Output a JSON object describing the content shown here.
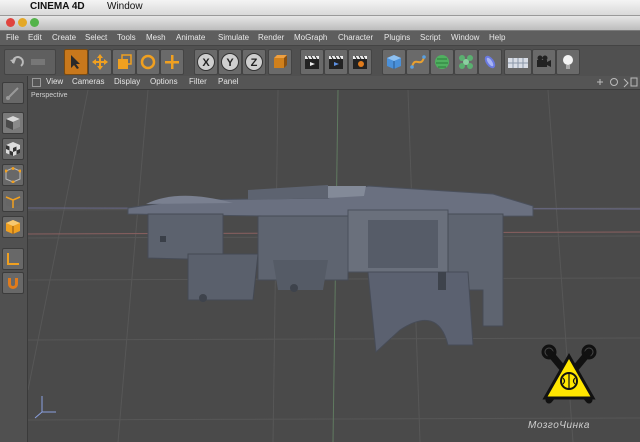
{
  "os_menubar": {
    "apple": "",
    "app": "CINEMA 4D",
    "window": "Window"
  },
  "app_menu": {
    "items": [
      "File",
      "Edit",
      "Create",
      "Select",
      "Tools",
      "Mesh",
      "Animate",
      "Simulate",
      "Render",
      "MoGraph",
      "Character",
      "Plugins",
      "Script",
      "Window",
      "Help"
    ]
  },
  "toolbar": {
    "x": "X",
    "y": "Y",
    "z": "Z"
  },
  "viewport_menu": {
    "items": [
      "View",
      "Cameras",
      "Display",
      "Options",
      "Filter",
      "Panel"
    ]
  },
  "viewport": {
    "label": "Perspective"
  },
  "watermark": {
    "text": "MозгоЧинка"
  },
  "colors": {
    "accent_orange": "#f0a020",
    "close": "#e0443e",
    "minimize": "#e4a827",
    "zoom": "#54b34a"
  }
}
